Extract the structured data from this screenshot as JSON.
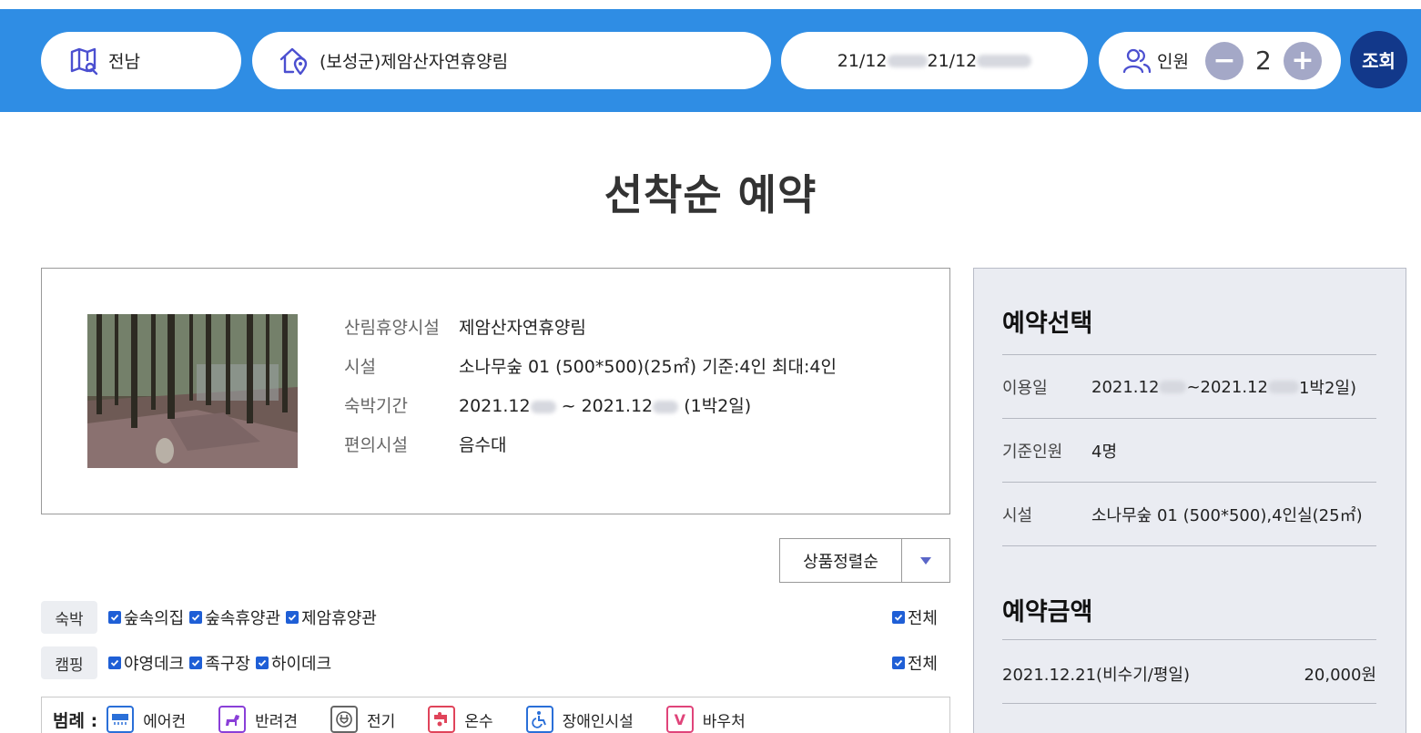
{
  "search": {
    "region": "전남",
    "place": "(보성군)제암산자연휴양림",
    "date_start_prefix": "21/12",
    "date_sep": "/",
    "date_end_prefix": "21/12",
    "people_label": "인원",
    "people_count": "2",
    "minus": "−",
    "plus": "+",
    "submit": "조회"
  },
  "page_title": "선착순 예약",
  "info": {
    "rows": [
      {
        "label": "산림휴양시설",
        "value": "제암산자연휴양림"
      },
      {
        "label": "시설",
        "value": "소나무숲 01 (500*500)(25㎡) 기준:4인 최대:4인"
      },
      {
        "label": "숙박기간",
        "value_a": "2021.12",
        "value_b": " ~ 2021.12",
        "value_c": " (1박2일)"
      },
      {
        "label": "편의시설",
        "value": "음수대"
      }
    ]
  },
  "sort": {
    "label": "상품정렬순"
  },
  "filters": [
    {
      "tag": "숙박",
      "options": [
        "숲속의집",
        "숲속휴양관",
        "제암휴양관"
      ],
      "all": "전체"
    },
    {
      "tag": "캠핑",
      "options": [
        "야영데크",
        "족구장",
        "하이데크"
      ],
      "all": "전체"
    }
  ],
  "legend": {
    "title": "범례 :",
    "items": [
      "에어컨",
      "반려견",
      "전기",
      "온수",
      "장애인시설",
      "바우처"
    ]
  },
  "side": {
    "select_title": "예약선택",
    "use_date_label": "이용일",
    "use_date_a": "2021.12",
    "use_date_b": "~2021.12",
    "use_date_c": "1박2일)",
    "base_people_label": "기준인원",
    "base_people_value": "4명",
    "facility_label": "시설",
    "facility_value": "소나무숲 01 (500*500),4인실(25㎡)",
    "amount_title": "예약금액",
    "amount_date": "2021.12.21(비수기/평일)",
    "amount_value": "20,000원"
  },
  "colors": {
    "topbar": "#2f8de4",
    "search_button": "#12388a",
    "checkbox": "#1f5fd6"
  }
}
